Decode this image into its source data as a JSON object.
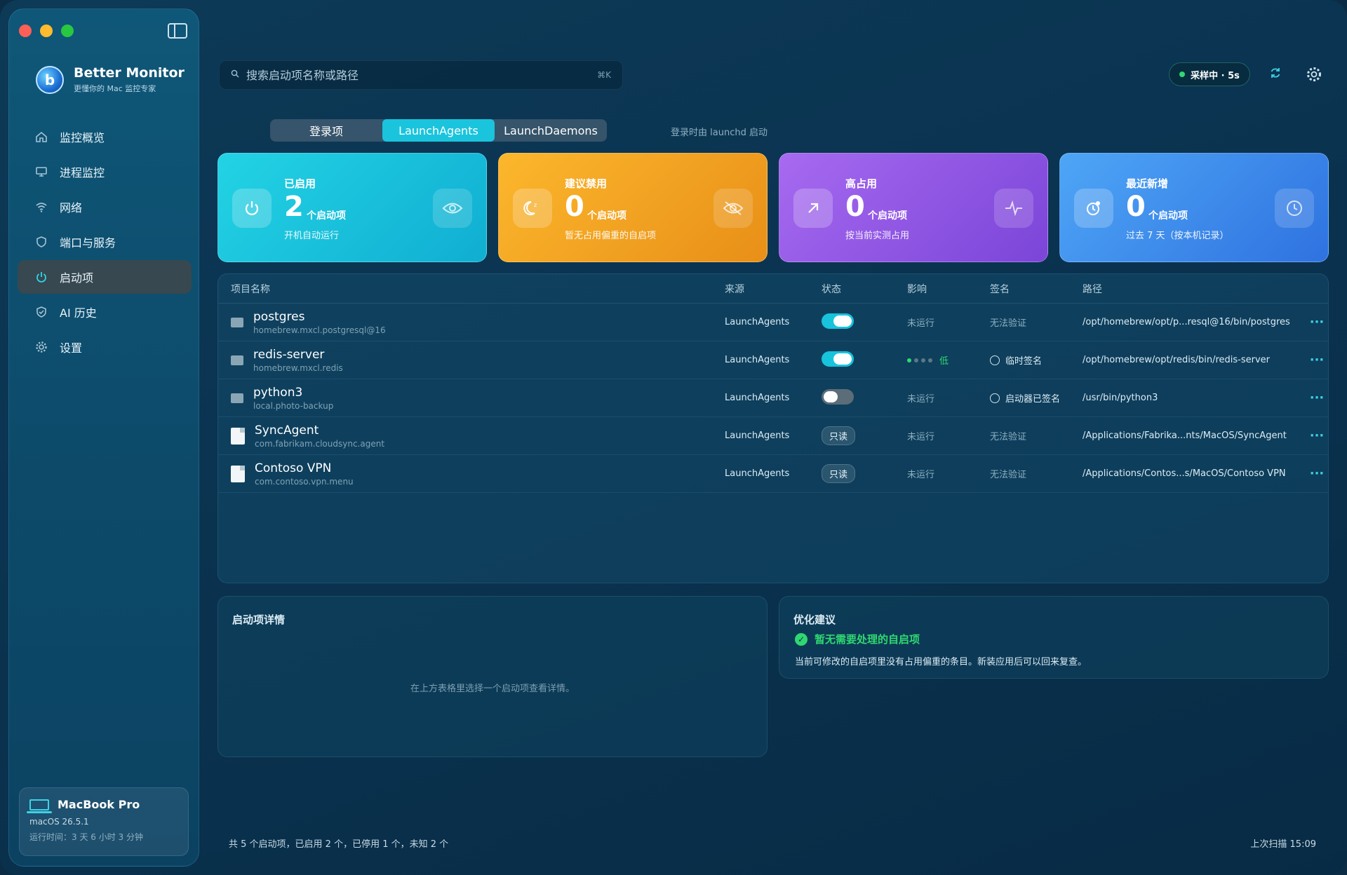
{
  "app": {
    "name": "Better Monitor",
    "tagline": "更懂你的 Mac 监控专家"
  },
  "sidebar": {
    "items": [
      {
        "label": "监控概览",
        "icon": "home-icon"
      },
      {
        "label": "进程监控",
        "icon": "monitor-icon"
      },
      {
        "label": "网络",
        "icon": "wifi-icon"
      },
      {
        "label": "端口与服务",
        "icon": "shield-icon"
      },
      {
        "label": "启动项",
        "icon": "power-icon",
        "active": true
      },
      {
        "label": "AI 历史",
        "icon": "shield-check-icon"
      },
      {
        "label": "设置",
        "icon": "gear-icon"
      }
    ],
    "device": {
      "name": "MacBook Pro",
      "os": "macOS 26.5.1",
      "uptime": "运行时间：3 天 6 小时 3 分钟"
    }
  },
  "topbar": {
    "search_placeholder": "搜索启动项名称或路径",
    "search_shortcut": "⌘K",
    "sampling": "采样中 · 5s"
  },
  "tabs": {
    "items": [
      "登录项",
      "LaunchAgents",
      "LaunchDaemons"
    ],
    "active": "LaunchAgents",
    "hint": "登录时由 launchd 启动"
  },
  "cards": [
    {
      "label": "已启用",
      "value": "2",
      "unit": "个启动项",
      "sub": "开机自动运行"
    },
    {
      "label": "建议禁用",
      "value": "0",
      "unit": "个启动项",
      "sub": "暂无占用偏重的自启项"
    },
    {
      "label": "高占用",
      "value": "0",
      "unit": "个启动项",
      "sub": "按当前实测占用"
    },
    {
      "label": "最近新增",
      "value": "0",
      "unit": "个启动项",
      "sub": "过去 7 天（按本机记录）"
    }
  ],
  "table": {
    "headers": [
      "项目名称",
      "来源",
      "状态",
      "影响",
      "签名",
      "路径"
    ],
    "rows": [
      {
        "name": "postgres",
        "id": "homebrew.mxcl.postgresql@16",
        "source": "LaunchAgents",
        "status": "on",
        "impact": "未运行",
        "sign": "无法验证",
        "path": "/opt/homebrew/opt/p...resql@16/bin/postgres"
      },
      {
        "name": "redis-server",
        "id": "homebrew.mxcl.redis",
        "source": "LaunchAgents",
        "status": "on",
        "impact": "低",
        "sign": "临时签名",
        "path": "/opt/homebrew/opt/redis/bin/redis-server"
      },
      {
        "name": "python3",
        "id": "local.photo-backup",
        "source": "LaunchAgents",
        "status": "off",
        "impact": "未运行",
        "sign": "启动器已签名",
        "path": "/usr/bin/python3"
      },
      {
        "name": "SyncAgent",
        "id": "com.fabrikam.cloudsync.agent",
        "source": "LaunchAgents",
        "status": "只读",
        "impact": "未运行",
        "sign": "无法验证",
        "path": "/Applications/Fabrika...nts/MacOS/SyncAgent"
      },
      {
        "name": "Contoso VPN",
        "id": "com.contoso.vpn.menu",
        "source": "LaunchAgents",
        "status": "只读",
        "impact": "未运行",
        "sign": "无法验证",
        "path": "/Applications/Contos...s/MacOS/Contoso VPN"
      }
    ]
  },
  "detail": {
    "title": "启动项详情",
    "empty": "在上方表格里选择一个启动项查看详情。"
  },
  "optimize": {
    "title": "优化建议",
    "ok": "暂无需要处理的自启项",
    "desc": "当前可修改的自启项里没有占用偏重的条目。新装应用后可以回来复查。"
  },
  "footer": {
    "summary": "共 5 个启动项，已启用 2 个，已停用 1 个，未知 2 个",
    "last_scan": "上次扫描 15:09"
  }
}
